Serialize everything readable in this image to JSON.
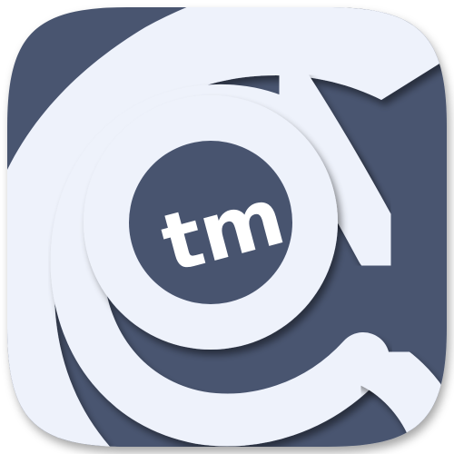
{
  "app_icon": {
    "glyph_text": "tm",
    "colors": {
      "background": "#ffffff",
      "tile": "#48546f",
      "ring": "#eef2fb",
      "glyph": "#ffffff",
      "shadow": "#1b2236"
    }
  }
}
